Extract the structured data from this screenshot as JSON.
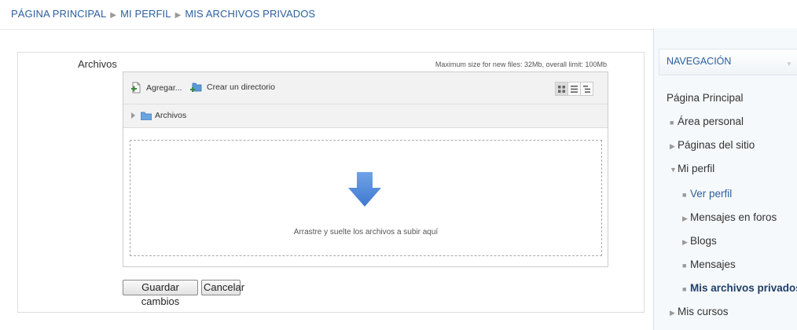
{
  "breadcrumb": {
    "home": "PÁGINA PRINCIPAL",
    "profile": "MI PERFIL",
    "current": "MIS ARCHIVOS PRIVADOS",
    "separator": "▶"
  },
  "form": {
    "field_label": "Archivos",
    "max_size": "Maximum size for new files: 32Mb, overall limit: 100Mb",
    "add_label": "Agregar...",
    "mkdir_label": "Crear un directorio",
    "path_folder": "Archivos",
    "drop_hint": "Arrastre y suelte los archivos a subir aquí",
    "save_label": "Guardar cambios",
    "cancel_label": "Cancelar"
  },
  "navigation": {
    "title": "NAVEGACIÓN",
    "home": "Página Principal",
    "items": [
      {
        "label": "Área personal",
        "marker": "■"
      },
      {
        "label": "Páginas del sitio",
        "marker": "▶"
      },
      {
        "label": "Mi perfil",
        "marker": "▼"
      },
      {
        "label": "Ver perfil",
        "marker": "■"
      },
      {
        "label": "Mensajes en foros",
        "marker": "▶"
      },
      {
        "label": "Blogs",
        "marker": "▶"
      },
      {
        "label": "Mensajes",
        "marker": "■"
      },
      {
        "label": "Mis archivos privados",
        "marker": "■"
      },
      {
        "label": "Mis cursos",
        "marker": "▶"
      }
    ]
  },
  "colors": {
    "link": "#2b5f9e",
    "arrow": "#4a86d6"
  }
}
